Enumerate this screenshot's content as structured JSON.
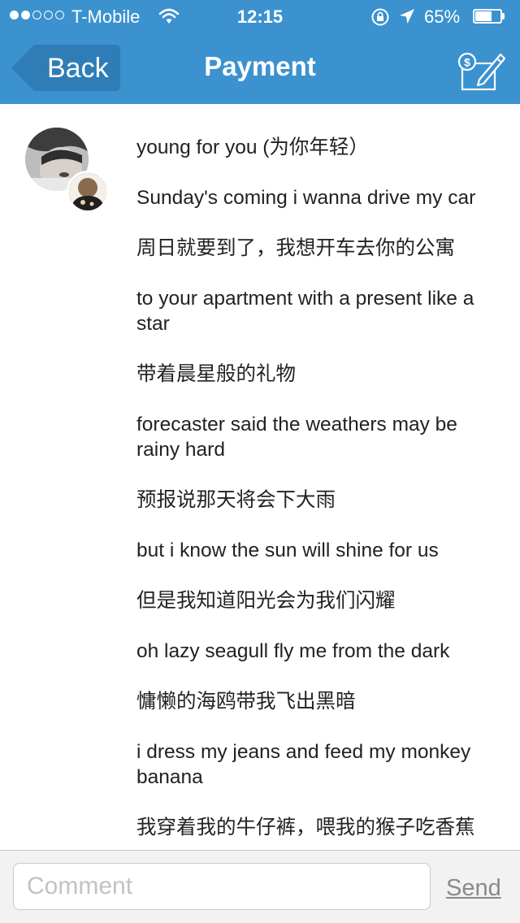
{
  "status_bar": {
    "carrier": "T-Mobile",
    "time": "12:15",
    "battery_percent": "65%",
    "battery_level": 0.65,
    "signal_bars_filled": 2,
    "signal_bars_total": 5
  },
  "nav": {
    "back_label": "Back",
    "title": "Payment",
    "compose_icon": "payment-compose-icon",
    "background_color": "#3b92cf"
  },
  "post": {
    "lines": [
      "young for you (为你年轻）",
      "Sunday's coming i wanna drive my car",
      "周日就要到了，我想开车去你的公寓",
      "to your apartment with a present like a star",
      "带着晨星般的礼物",
      "forecaster said the weathers may be rainy hard",
      "预报说那天将会下大雨",
      "but i know the sun will shine for us",
      "但是我知道阳光会为我们闪耀",
      "oh lazy seagull fly me from the dark",
      "慵懒的海鸥带我飞出黑暗",
      "i dress my jeans and feed my monkey banana",
      "我穿着我的牛仔裤，喂我的猴子吃香蕉"
    ]
  },
  "comment": {
    "placeholder": "Comment",
    "value": "",
    "send_label": "Send"
  }
}
